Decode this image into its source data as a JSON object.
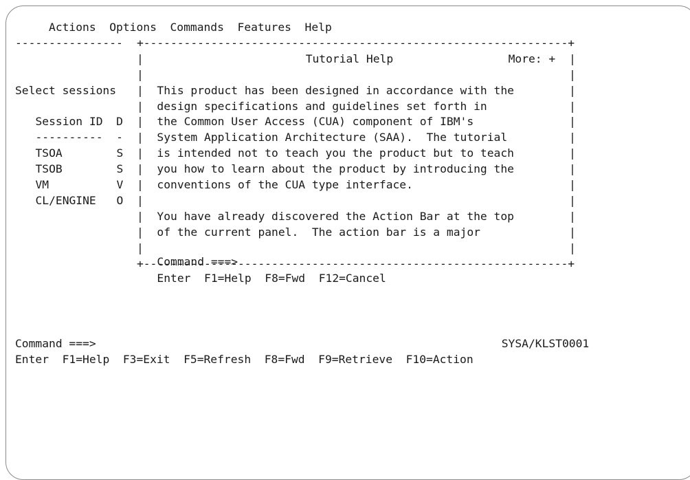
{
  "menu_bar": {
    "items": [
      "Actions",
      "Options",
      "Commands",
      "Features",
      "Help"
    ]
  },
  "left_panel": {
    "title": "Select sessions",
    "columns": [
      "Session ID",
      "D"
    ],
    "underline": [
      "----------",
      "-"
    ],
    "rows": [
      {
        "id": "TSOA",
        "d": "S"
      },
      {
        "id": "TSOB",
        "d": "S"
      },
      {
        "id": "VM",
        "d": "V"
      },
      {
        "id": "CL/ENGINE",
        "d": "O"
      }
    ]
  },
  "popup": {
    "title": "Tutorial Help",
    "more": "More: +",
    "paragraph1": [
      "This product has been designed in accordance with the",
      "design specifications and guidelines set forth in",
      "the Common User Access (CUA) component of IBM's",
      "System Application Architecture (SAA).  The tutorial",
      "is intended not to teach you the product but to teach",
      "you how to learn about the product by introducing the",
      "conventions of the CUA type interface."
    ],
    "paragraph2": [
      "You have already discovered the Action Bar at the top",
      "of the current panel.  The action bar is a major"
    ],
    "command_label": "Command ===>",
    "keys": [
      "Enter",
      "F1=Help",
      "F8=Fwd",
      "F12=Cancel"
    ]
  },
  "bottom": {
    "command_label": "Command ===>",
    "system_id": "SYSA/KLST0001",
    "keys": [
      "Enter",
      "F1=Help",
      "F3=Exit",
      "F5=Refresh",
      "F8=Fwd",
      "F9=Retrieve",
      "F10=Action"
    ]
  }
}
